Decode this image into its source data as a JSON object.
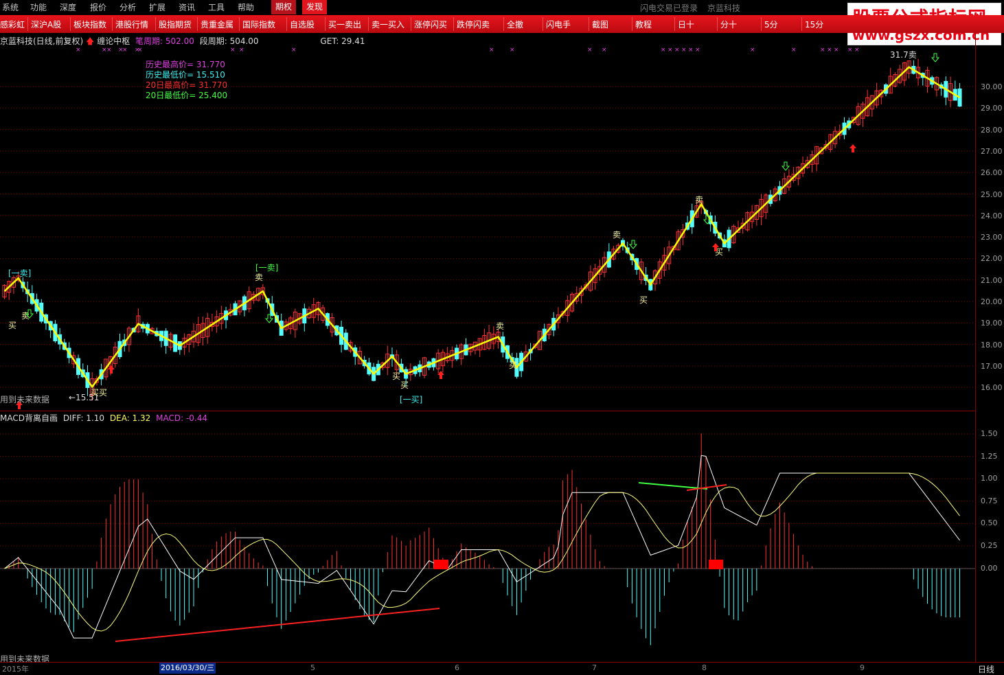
{
  "menu": [
    "系统",
    "功能",
    "深度",
    "报价",
    "分析",
    "扩展",
    "资讯",
    "工具",
    "帮助"
  ],
  "menu_highlights": [
    {
      "label": "期权",
      "color": "#b5121b"
    },
    {
      "label": "发现",
      "color": "#e0141c"
    }
  ],
  "status": {
    "login": "闪电交易已登录",
    "stock": "京蓝科技"
  },
  "logo": {
    "line1": "股票公式指标网",
    "line2": "www.gszx.com.cn"
  },
  "toolbar": [
    "感彩虹",
    "深沪A股",
    "板块指数",
    "港股行情",
    "股指期货",
    "贵重金属",
    "国际指数",
    "自选股",
    "买一卖出",
    "卖一买入",
    "涨停闪买",
    "跌停闪卖",
    "全撤",
    "闪电手",
    "截图",
    "教程",
    "日十",
    "分十",
    "5分",
    "15分"
  ],
  "info": {
    "title": "京蓝科技(日线,前复权)",
    "indicator": "缠论中枢",
    "bi_label": "笔周期: 502.00",
    "duan_label": "段周期: 504.00",
    "get_label": "GET: 29.41"
  },
  "stats": [
    {
      "text": "历史最高价= 31.770",
      "color": "#e040e0"
    },
    {
      "text": "历史最低价= 15.510",
      "color": "#40f0f0"
    },
    {
      "text": "20日最高价= 31.770",
      "color": "#ff3030"
    },
    {
      "text": "20日最低价= 25.400",
      "color": "#40ff40"
    }
  ],
  "future_note": "用到未来数据",
  "price_labels": [
    "30.00",
    "29.00",
    "28.00",
    "27.00",
    "26.00",
    "25.00",
    "24.00",
    "23.00",
    "22.00",
    "21.00",
    "20.00",
    "19.00",
    "18.00",
    "17.00",
    "16.00"
  ],
  "macd_labels": [
    "1.50",
    "1.25",
    "1.00",
    "0.75",
    "0.50",
    "0.25",
    "0.00"
  ],
  "annotations": {
    "low_mark": "←15.51",
    "high_mark": "31.7卖",
    "yi_mai": "[一卖]",
    "yi_mai2": "[一卖]",
    "yi_buy": "[一买]",
    "buy": "买",
    "sell": "卖",
    "buybuy": "买买"
  },
  "macd": {
    "title": "MACD背离自画",
    "diff": "DIFF: 1.10",
    "dea": "DEA: 1.32",
    "macd": "MACD: -0.44"
  },
  "bottom": {
    "year": "2015年",
    "date": "2016/03/30/三",
    "months": [
      "5",
      "6",
      "7",
      "8",
      "9"
    ],
    "period": "日线"
  },
  "colors": {
    "up": "#ff3232",
    "down": "#54ffff",
    "zigzag": "#ffff00",
    "grid": "#8b0000"
  },
  "chart_data": {
    "type": "candlestick",
    "title": "京蓝科技(日线,前复权)",
    "ylim": [
      15.3,
      31.9
    ],
    "zigzag": [
      [
        0,
        20.6
      ],
      [
        3,
        21.2
      ],
      [
        19,
        16.2
      ],
      [
        29,
        19.1
      ],
      [
        38,
        18.1
      ],
      [
        56,
        20.6
      ],
      [
        60,
        18.9
      ],
      [
        68,
        19.8
      ],
      [
        80,
        16.8
      ],
      [
        84,
        17.6
      ],
      [
        87,
        16.8
      ],
      [
        107,
        18.5
      ],
      [
        111,
        17.1
      ],
      [
        134,
        22.8
      ],
      [
        140,
        20.9
      ],
      [
        151,
        24.6
      ],
      [
        156,
        22.8
      ],
      [
        196,
        30.9
      ],
      [
        207,
        29.5
      ]
    ],
    "macd_zero_y": 828,
    "macd_ylim": [
      -1.0,
      1.6
    ]
  }
}
